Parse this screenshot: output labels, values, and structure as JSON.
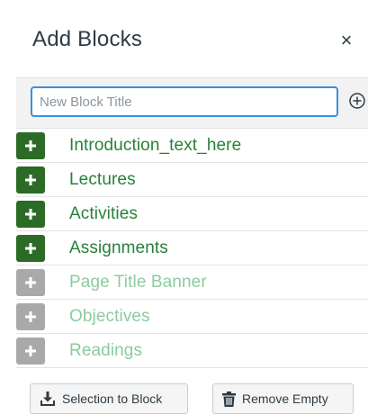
{
  "dialog": {
    "title": "Add Blocks",
    "close_glyph": "×"
  },
  "input": {
    "placeholder": "New Block Title",
    "value": ""
  },
  "blocks": [
    {
      "label": "Introduction_text_here",
      "state": "active"
    },
    {
      "label": "Lectures",
      "state": "active"
    },
    {
      "label": "Activities",
      "state": "active"
    },
    {
      "label": "Assignments",
      "state": "active"
    },
    {
      "label": "Page Title Banner",
      "state": "inactive"
    },
    {
      "label": "Objectives",
      "state": "inactive"
    },
    {
      "label": "Readings",
      "state": "inactive"
    }
  ],
  "footer": {
    "selection_label": "Selection to Block",
    "remove_label": "Remove Empty"
  },
  "icons": {
    "close": "close-icon",
    "add_circle": "add-circle-icon",
    "plus": "plus-icon",
    "download": "download-icon",
    "trash": "trash-icon"
  },
  "colors": {
    "active_box": "#2c6b25",
    "inactive_box": "#a9a9a9",
    "active_text": "#27813a",
    "inactive_text": "#8ccb9e",
    "input_border": "#3b8fd9"
  }
}
